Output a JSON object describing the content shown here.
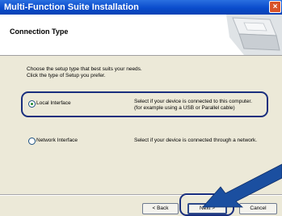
{
  "window": {
    "title": "Multi-Function Suite Installation",
    "close_glyph": "×"
  },
  "header": {
    "title": "Connection Type"
  },
  "intro": {
    "line1": "Choose the setup type that best suits your needs.",
    "line2": "Click the type of Setup you prefer."
  },
  "options": [
    {
      "label": "Local Interface",
      "desc_line1": "Select if your device is connected to this computer.",
      "desc_line2": "(for example using a USB or Parallel cable)",
      "selected": true
    },
    {
      "label": "Network Interface",
      "desc_line1": "Select if your device is connected through a network.",
      "selected": false
    }
  ],
  "buttons": {
    "back": "< Back",
    "next": "Next >",
    "cancel": "Cancel"
  },
  "colors": {
    "titlebar": "#0a4ccc",
    "highlight": "#1a2f7e",
    "arrow": "#1b4fa0",
    "radio_dot": "#1e8a2e"
  }
}
